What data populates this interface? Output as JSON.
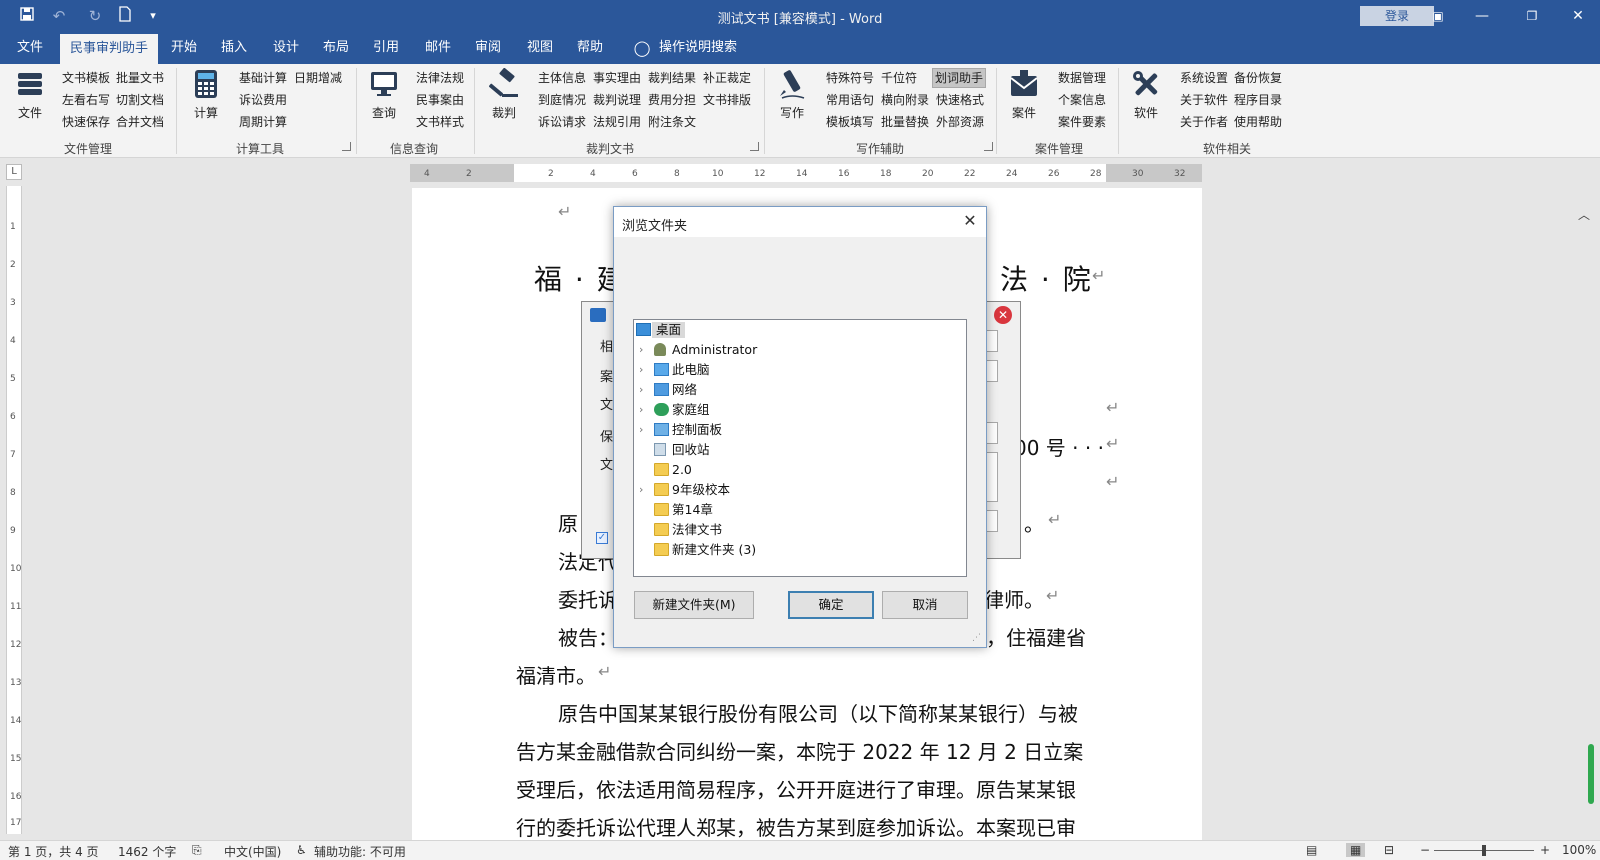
{
  "window": {
    "title": "测试文书 [兼容模式] - Word",
    "login": "登录",
    "quick_access": [
      "save-icon",
      "undo-icon",
      "redo-icon",
      "new-doc-icon",
      "customize-icon"
    ]
  },
  "tabs": [
    {
      "label": "文件",
      "active": false
    },
    {
      "label": "民事审判助手",
      "active": true
    },
    {
      "label": "开始",
      "active": false
    },
    {
      "label": "插入",
      "active": false
    },
    {
      "label": "设计",
      "active": false
    },
    {
      "label": "布局",
      "active": false
    },
    {
      "label": "引用",
      "active": false
    },
    {
      "label": "邮件",
      "active": false
    },
    {
      "label": "审阅",
      "active": false
    },
    {
      "label": "视图",
      "active": false
    },
    {
      "label": "帮助",
      "active": false
    },
    {
      "label": "操作说明搜索",
      "active": false
    }
  ],
  "ribbon": {
    "groups": [
      {
        "label": "文件管理",
        "big": "文件",
        "items": [
          "文书模板",
          "批量文书",
          "左看右写",
          "切割文档",
          "快速保存",
          "合并文档"
        ]
      },
      {
        "label": "计算工具",
        "big": "计算",
        "items": [
          "基础计算",
          "日期增减",
          "诉讼费用",
          "周期计算"
        ]
      },
      {
        "label": "信息查询",
        "big": "查询",
        "items": [
          "法律法规",
          "民事案由",
          "文书样式"
        ]
      },
      {
        "label": "裁判文书",
        "big": "裁判",
        "items": [
          "主体信息",
          "事实理由",
          "裁判结果",
          "补正裁定",
          "到庭情况",
          "裁判说理",
          "费用分担",
          "文书排版",
          "诉讼请求",
          "法规引用",
          "附注条文"
        ]
      },
      {
        "label": "写作辅助",
        "big": "写作",
        "items": [
          "特殊符号",
          "千位符",
          "划词助手",
          "常用语句",
          "横向附录",
          "快速格式",
          "模板填写",
          "批量替换",
          "外部资源"
        ]
      },
      {
        "label": "案件管理",
        "big": "案件",
        "items": [
          "数据管理",
          "个案信息",
          "案件要素"
        ]
      },
      {
        "label": "软件相关",
        "big": "软件",
        "items": [
          "系统设置",
          "备份恢复",
          "关于软件",
          "程序目录",
          "关于作者",
          "使用帮助"
        ]
      }
    ]
  },
  "ruler": {
    "ticks": [
      "4",
      "2",
      "2",
      "4",
      "6",
      "8",
      "10",
      "12",
      "14",
      "16",
      "18",
      "20",
      "22",
      "24",
      "26",
      "28",
      "30",
      "32"
    ],
    "vticks": [
      "1",
      "2",
      "3",
      "4",
      "5",
      "6",
      "7",
      "8",
      "9",
      "10",
      "11",
      "12",
      "13",
      "14",
      "15",
      "16",
      "17"
    ]
  },
  "document": {
    "court_title": "福 · 建",
    "court_title_right": "法 · 院",
    "case_no_tail": "00 号 · · ·",
    "lines": [
      "原",
      "法定代",
      "委托诉",
      "被告：方某，男，1970 年 5 月 6 日出生，汉族，住福建省",
      "福清市。",
      "原告中国某某银行股份有限公司（以下简称某某银行）与被",
      "告方某金融借款合同纠纷一案，本院于 2022 年 12 月 2 日立案",
      "受理后，依法适用简易程序，公开开庭进行了审理。原告某某银",
      "行的委托诉讼代理人郑某，被告方某到庭参加诉讼。本案现已审"
    ],
    "right_fragments": [
      "。",
      "律师。"
    ]
  },
  "save_dialog": {
    "labels": [
      "相",
      "案",
      "文",
      "保",
      "文"
    ]
  },
  "browse_dialog": {
    "title": "浏览文件夹",
    "tree": [
      {
        "label": "桌面",
        "icon": "desktop-icon",
        "expandable": false,
        "root": true
      },
      {
        "label": "Administrator",
        "icon": "user-icon",
        "expandable": true
      },
      {
        "label": "此电脑",
        "icon": "computer-icon",
        "expandable": true
      },
      {
        "label": "网络",
        "icon": "network-icon",
        "expandable": true
      },
      {
        "label": "家庭组",
        "icon": "homegroup-icon",
        "expandable": true
      },
      {
        "label": "控制面板",
        "icon": "control-panel-icon",
        "expandable": true
      },
      {
        "label": "回收站",
        "icon": "recycle-bin-icon",
        "expandable": false
      },
      {
        "label": "2.0",
        "icon": "folder-icon",
        "expandable": true
      },
      {
        "label": "9年级校本",
        "icon": "folder-icon",
        "expandable": true
      },
      {
        "label": "第14章",
        "icon": "folder-icon",
        "expandable": false
      },
      {
        "label": "法律文书",
        "icon": "folder-icon",
        "expandable": false
      },
      {
        "label": "新建文件夹 (3)",
        "icon": "folder-icon",
        "expandable": false
      }
    ],
    "new_folder_btn": "新建文件夹(M)",
    "ok_btn": "确定",
    "cancel_btn": "取消"
  },
  "statusbar": {
    "page": "第 1 页，共 4 页",
    "words": "1462 个字",
    "language": "中文(中国)",
    "accessibility": "辅助功能: 不可用",
    "zoom": "100%"
  },
  "colors": {
    "accent": "#2b579a",
    "ribbon_bg": "#f3f3f3",
    "folder": "#f4cc52"
  }
}
